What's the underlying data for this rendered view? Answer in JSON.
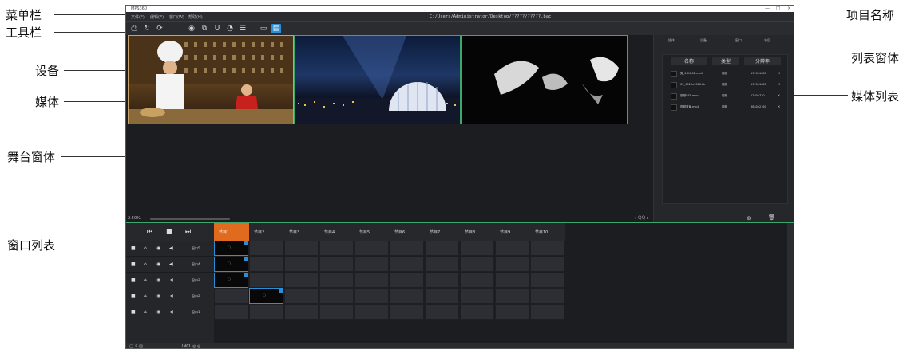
{
  "annotations": {
    "menubar": "菜单栏",
    "toolbar": "工具栏",
    "device": "设备",
    "media": "媒体",
    "stage": "舞台窗体",
    "window_list": "窗口列表",
    "project_name": "项目名称",
    "list_window": "列表窗体",
    "media_list": "媒体列表"
  },
  "app": {
    "title": "MPS360",
    "menu_items": [
      "文件(F)",
      "编辑(E)",
      "窗口(W)",
      "帮助(H)"
    ],
    "project_path": "C:/Users/Administrator/Desktop/?????/?????.bac",
    "window_controls": [
      "—",
      "□",
      "×"
    ]
  },
  "toolbar_icons": [
    "camera-icon",
    "redo-icon",
    "sync-icon",
    "play-circle-icon",
    "layers-icon",
    "magnet-icon",
    "shape-icon",
    "list-icon",
    "monitor-icon",
    "grid-icon"
  ],
  "stage": {
    "screen_labels": [
      "",
      "",
      ""
    ],
    "zoom": "2.50%",
    "zoom_ctrl": "◂ QQ ▸"
  },
  "media_panel": {
    "tabs": [
      "媒体",
      "设备",
      "窗口",
      "节目"
    ],
    "header": {
      "name": "名称",
      "type": "类型",
      "resolution": "分辨率"
    },
    "rows": [
      {
        "name": "剪_1-01-01.mp4",
        "type": "视频",
        "res": "1920x1080",
        "x": "×"
      },
      {
        "name": "05_1920x1080.bk",
        "type": "视频",
        "res": "1920x1080",
        "x": "×"
      },
      {
        "name": "视频CSS.mov",
        "type": "视频",
        "res": "1280x720",
        "x": "×"
      },
      {
        "name": "视频背景.mp4",
        "type": "视频",
        "res": "3840x2160",
        "x": "×"
      }
    ],
    "add": "⊕",
    "delete": "🗑"
  },
  "transport": [
    "⏮",
    "■",
    "⏭"
  ],
  "programs": [
    "节目1",
    "节目2",
    "节目3",
    "节目4",
    "节目5",
    "节目6",
    "节目7",
    "节目8",
    "节目9",
    "节目10"
  ],
  "windows": [
    {
      "name": "窗口5"
    },
    {
      "name": "窗口4"
    },
    {
      "name": "窗口3"
    },
    {
      "name": "窗口2"
    },
    {
      "name": "窗口1"
    }
  ],
  "status": {
    "left_icons": "▢ ⇪ ▤",
    "right": "INCL ◎ ◎"
  }
}
